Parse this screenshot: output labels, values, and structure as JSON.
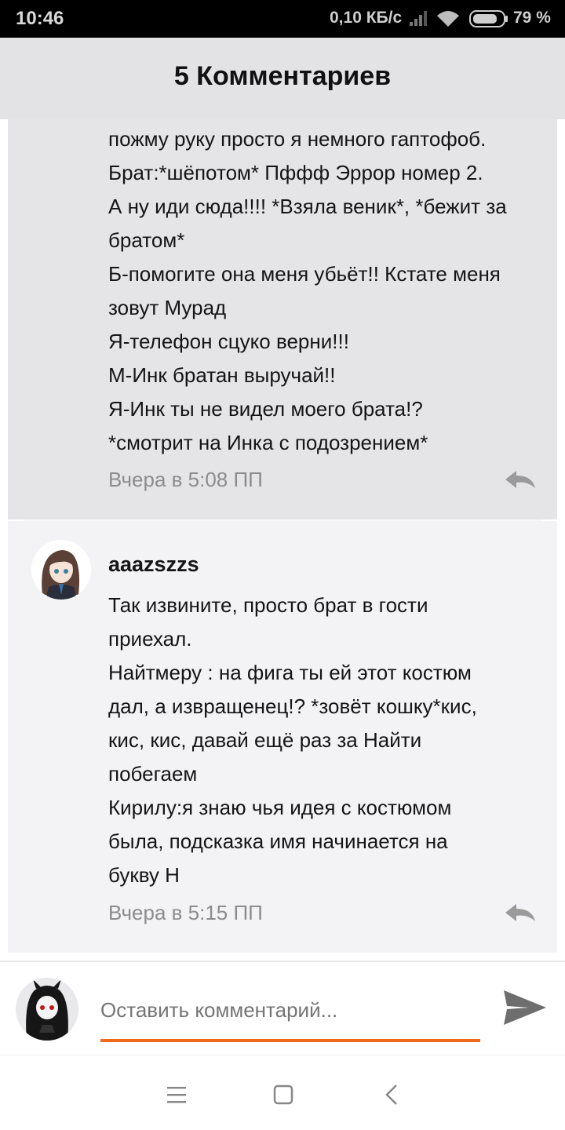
{
  "status_bar": {
    "time": "10:46",
    "network_speed": "0,10 КБ/с",
    "battery": "79 %"
  },
  "header": {
    "title": "5 Комментариев"
  },
  "comments": [
    {
      "lines": [
        "пожму руку просто я немного гаптофоб.",
        "Брат:*шёпотом* Пффф Эррор номер 2.",
        "А ну иди сюда!!!! *Взяла веник*, *бежит за",
        "братом*",
        "Б-помогите она меня убьёт!! Кстате меня",
        "зовут Мурад",
        "Я-телефон сцуко верни!!!",
        "М-Инк братан выручай!!",
        "Я-Инк ты не видел моего брата!?",
        "*смотрит на Инка с подозрением*"
      ],
      "timestamp": "Вчера в 5:08 ПП"
    },
    {
      "username": "aaazszzs",
      "lines": [
        "Так извините, просто брат в гости",
        "приехал.",
        "Найтмеру : на фига ты ей этот костюм",
        "дал, а извращенец!? *зовёт кошку*кис,",
        "кис, кис, давай ещё раз за Найти",
        "побегаем",
        "Кирилу:я знаю чья идея с костюмом",
        "была, подсказка имя начинается на",
        "букву Н"
      ],
      "timestamp": "Вчера в 5:15 ПП"
    }
  ],
  "composer": {
    "placeholder": "Оставить комментарий..."
  },
  "colors": {
    "accent": "#f06a1e",
    "header_bg": "#e3e3e6",
    "comment_bg": "#e5e5e7",
    "comment_bg_alt": "#f3f3f6"
  },
  "icons": {
    "reply": "reply-arrow-icon",
    "send": "send-icon",
    "nav_menu": "menu-icon",
    "nav_home": "home-square-icon",
    "nav_back": "back-chevron-icon"
  }
}
